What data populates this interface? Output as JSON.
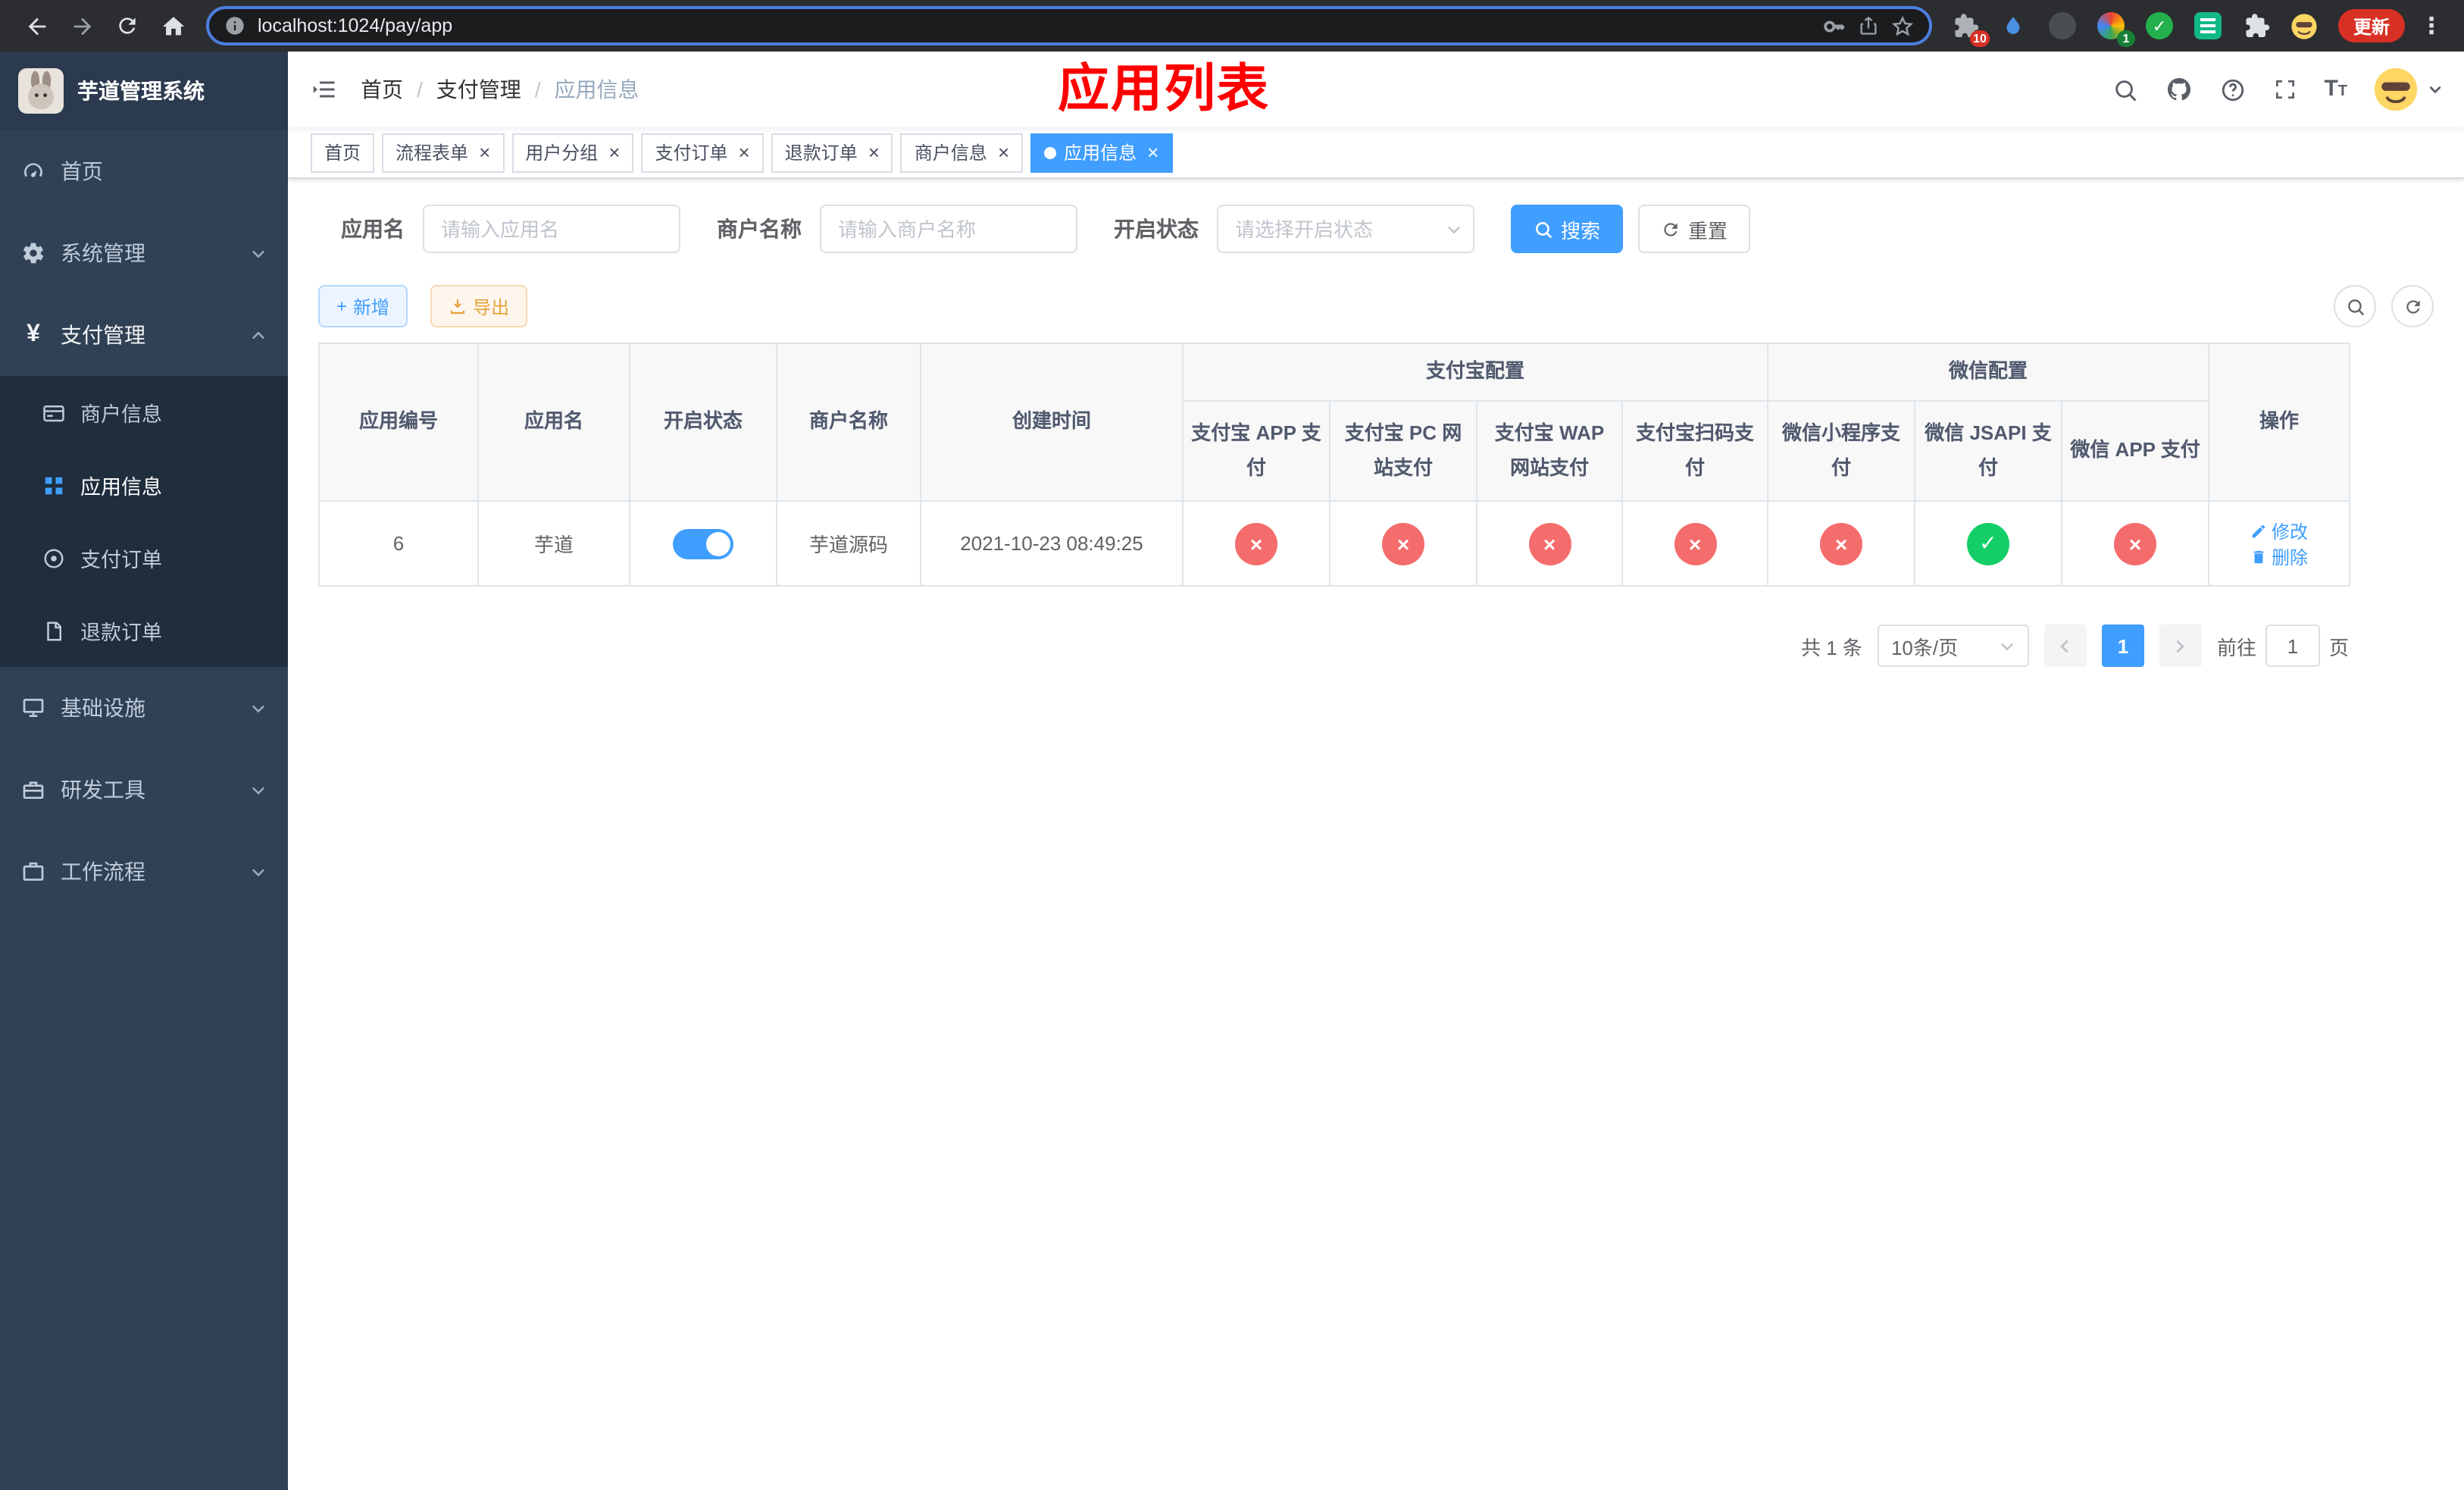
{
  "colors": {
    "primary": "#409eff",
    "success": "#13ce66",
    "danger": "#f56c6c",
    "warning": "#e6a23c",
    "annotation": "#ff0000",
    "sidebar_bg": "#304156",
    "sidebar_submenu_bg": "#1f2d3d",
    "update_button_bg": "#d93025"
  },
  "icons": {
    "close": "×",
    "check": "✓",
    "cross": "×",
    "plus": "+",
    "yen": "¥",
    "dots_menu": "⋮",
    "font_size_large": "T",
    "font_size_small": "T"
  },
  "browser": {
    "url": "localhost:1024/pay/app",
    "update_label": "更新",
    "puzzle_badge": "10",
    "colorwheel_badge": "1"
  },
  "sidebar": {
    "app_title": "芋道管理系统",
    "menu": [
      {
        "label": "首页"
      },
      {
        "label": "系统管理"
      },
      {
        "label": "支付管理"
      },
      {
        "label": "基础设施"
      },
      {
        "label": "研发工具"
      },
      {
        "label": "工作流程"
      }
    ],
    "payment_submenu": [
      {
        "label": "商户信息"
      },
      {
        "label": "应用信息"
      },
      {
        "label": "支付订单"
      },
      {
        "label": "退款订单"
      }
    ]
  },
  "header": {
    "breadcrumb": [
      "首页",
      "支付管理",
      "应用信息"
    ],
    "breadcrumb_separator": "/",
    "annotation": "应用列表"
  },
  "tabs": [
    {
      "label": "首页"
    },
    {
      "label": "流程表单"
    },
    {
      "label": "用户分组"
    },
    {
      "label": "支付订单"
    },
    {
      "label": "退款订单"
    },
    {
      "label": "商户信息"
    },
    {
      "label": "应用信息"
    }
  ],
  "filter": {
    "app_name": {
      "label": "应用名",
      "placeholder": "请输入应用名"
    },
    "merchant_name": {
      "label": "商户名称",
      "placeholder": "请输入商户名称"
    },
    "status": {
      "label": "开启状态",
      "placeholder": "请选择开启状态"
    },
    "search_label": "搜索",
    "reset_label": "重置"
  },
  "toolbar": {
    "add_label": "新增",
    "export_label": "导出"
  },
  "table": {
    "columns": {
      "app_id": "应用编号",
      "app_name": "应用名",
      "status": "开启状态",
      "merchant": "商户名称",
      "created": "创建时间",
      "alipay_group": "支付宝配置",
      "wechat_group": "微信配置",
      "alipay_app": "支付宝 APP 支付",
      "alipay_pc": "支付宝 PC 网站支付",
      "alipay_wap": "支付宝 WAP 网站支付",
      "alipay_qr": "支付宝扫码支付",
      "wechat_mini": "微信小程序支付",
      "wechat_jsapi": "微信 JSAPI 支付",
      "wechat_app": "微信 APP 支付",
      "actions": "操作"
    },
    "rows": [
      {
        "app_id": "6",
        "app_name": "芋道",
        "enabled": true,
        "merchant": "芋道源码",
        "created": "2021-10-23 08:49:25",
        "statuses": [
          false,
          false,
          false,
          false,
          false,
          true,
          false
        ],
        "edit_label": "修改",
        "delete_label": "删除"
      }
    ]
  },
  "pagination": {
    "total": "共 1 条",
    "page_size": "10条/页",
    "page": "1",
    "goto_label": "前往",
    "goto_value": "1",
    "goto_unit": "页"
  }
}
